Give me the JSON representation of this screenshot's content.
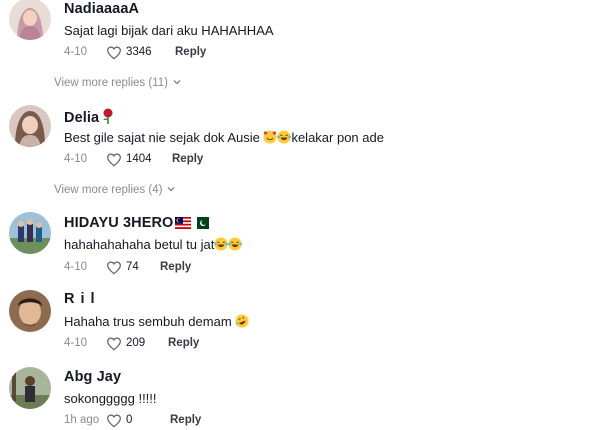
{
  "comments": [
    {
      "username": "NadiaaaaA",
      "text": "Sajat lagi bijak dari aku HAHAHHAA",
      "date": "4-10",
      "likes": "3346",
      "reply_label": "Reply",
      "view_more": "View more replies (11)"
    },
    {
      "username": "Delia",
      "text": "Best gile sajat nie sejak dok Ausie ",
      "text_after_emoji": "kelakar pon ade",
      "date": "4-10",
      "likes": "1404",
      "reply_label": "Reply",
      "view_more": "View more replies (4)"
    },
    {
      "username": "HIDAYU 3HERO",
      "text": "hahahahahaha betul tu jat",
      "date": "4-10",
      "likes": "74",
      "reply_label": "Reply"
    },
    {
      "username": "R i l",
      "text": "Hahaha trus sembuh demam ",
      "date": "4-10",
      "likes": "209",
      "reply_label": "Reply"
    },
    {
      "username": "Abg Jay",
      "text": "sokonggggg !!!!!",
      "date": "1h ago",
      "likes": "0",
      "reply_label": "Reply"
    }
  ],
  "icons": {
    "heart": "heart-outline-icon",
    "chevron": "chevron-down-icon"
  },
  "colors": {
    "meta_gray": "#8a8b91",
    "text_dark": "#161823"
  }
}
